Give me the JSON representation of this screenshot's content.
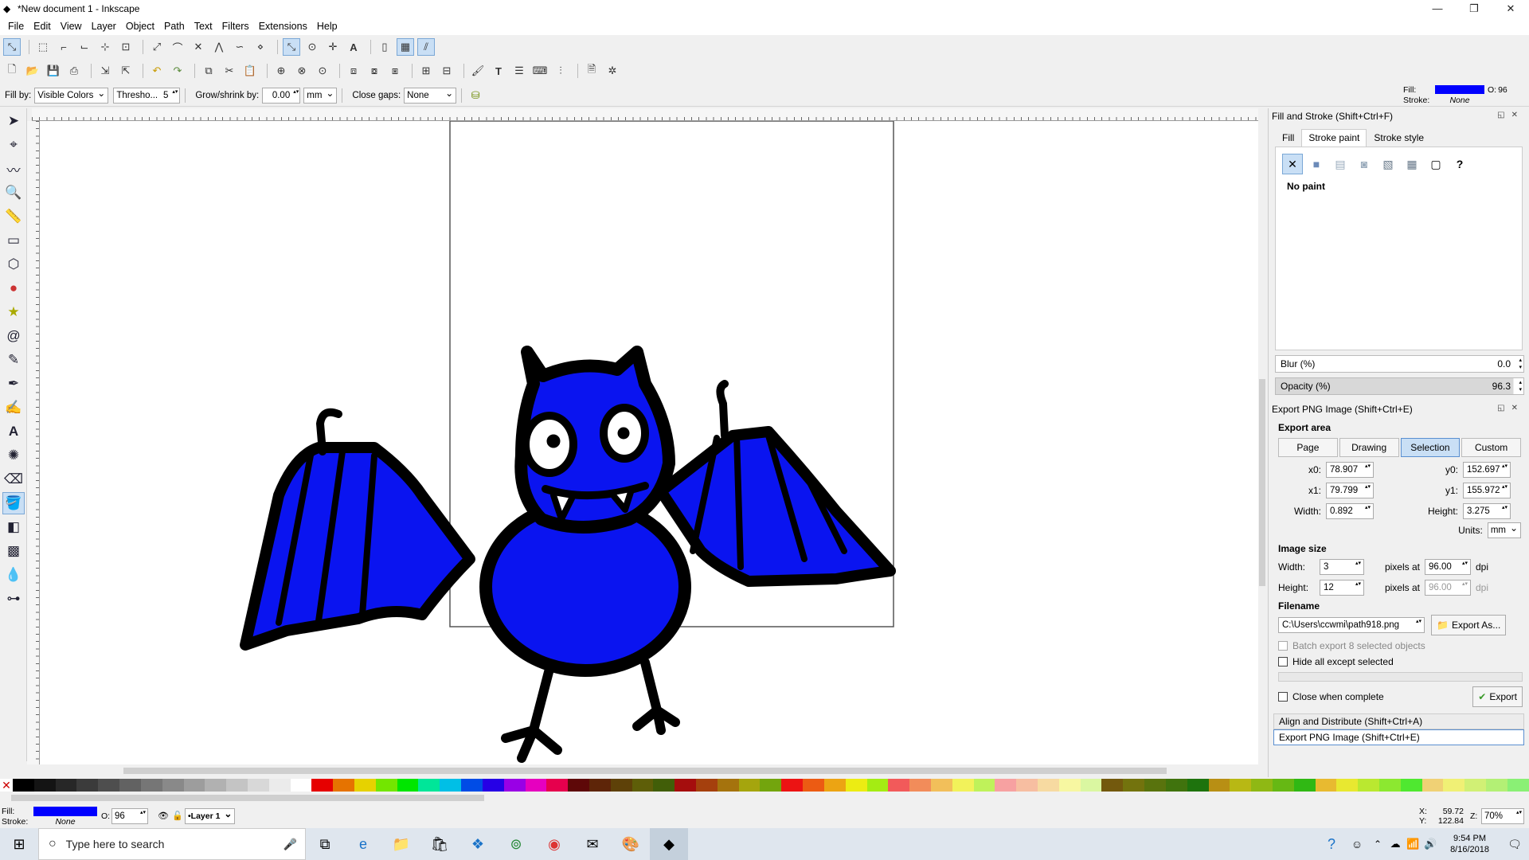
{
  "window": {
    "title": "*New document 1 - Inkscape"
  },
  "menu": [
    "File",
    "Edit",
    "View",
    "Layer",
    "Object",
    "Path",
    "Text",
    "Filters",
    "Extensions",
    "Help"
  ],
  "toolcontrols": {
    "fill_by_label": "Fill by:",
    "fill_by_value": "Visible Colors",
    "threshold_label": "Thresho...",
    "threshold_value": "5",
    "grow_label": "Grow/shrink by:",
    "grow_value": "0.00",
    "grow_unit": "mm",
    "gaps_label": "Close gaps:",
    "gaps_value": "None"
  },
  "style_indicator": {
    "fill_label": "Fill:",
    "stroke_label": "Stroke:",
    "stroke_value": "None",
    "opacity_label": "O:",
    "opacity_value": "96",
    "fill_color": "#0000ff"
  },
  "fill_stroke": {
    "title": "Fill and Stroke (Shift+Ctrl+F)",
    "tabs": [
      "Fill",
      "Stroke paint",
      "Stroke style"
    ],
    "active_tab": "Stroke paint",
    "paint_mode": "No paint",
    "blur_label": "Blur (%)",
    "blur_value": "0.0",
    "opacity_label": "Opacity (%)",
    "opacity_value": "96.3",
    "opacity_fraction": 0.963
  },
  "export": {
    "title": "Export PNG Image (Shift+Ctrl+E)",
    "area_label": "Export area",
    "area_buttons": [
      "Page",
      "Drawing",
      "Selection",
      "Custom"
    ],
    "active_area": "Selection",
    "x0_label": "x0:",
    "x0": "78.907",
    "y0_label": "y0:",
    "y0": "152.697",
    "x1_label": "x1:",
    "x1": "79.799",
    "y1_label": "y1:",
    "y1": "155.972",
    "width_label": "Width:",
    "width": "0.892",
    "height_label": "Height:",
    "height": "3.275",
    "units_label": "Units:",
    "units": "mm",
    "image_size_label": "Image size",
    "img_width": "3",
    "img_height": "12",
    "pixels_at": "pixels at",
    "dpi": "96.00",
    "dpi_unit": "dpi",
    "filename_label": "Filename",
    "filename": "C:\\Users\\ccwmi\\path918.png",
    "export_as": "Export As...",
    "batch_label": "Batch export 8 selected objects",
    "hide_label": "Hide all except selected",
    "close_label": "Close when complete",
    "export_button": "Export"
  },
  "collapsed_panels": [
    "Align and Distribute (Shift+Ctrl+A)",
    "Export PNG Image (Shift+Ctrl+E)"
  ],
  "statusbar": {
    "fill_label": "Fill:",
    "stroke_label": "Stroke:",
    "stroke_value": "None",
    "opacity_label": "O:",
    "opacity_value": "96",
    "layer": "•Layer 1",
    "x_label": "X:",
    "x": "59.72",
    "y_label": "Y:",
    "y": "122.84",
    "zoom_label": "Z:",
    "zoom": "70%"
  },
  "taskbar": {
    "search_placeholder": "Type here to search",
    "time": "9:54 PM",
    "date": "8/16/2018"
  },
  "colors": {
    "bat_fill": "#0a14f0",
    "selection": "#c9dff5"
  }
}
